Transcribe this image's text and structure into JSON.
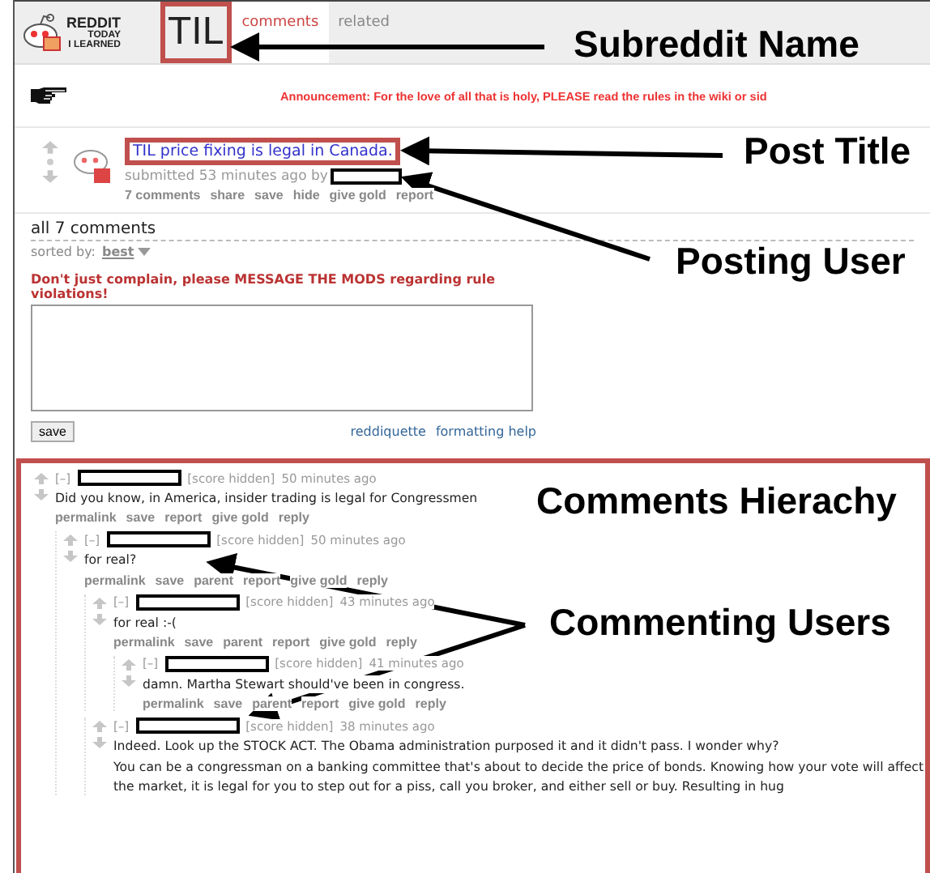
{
  "header": {
    "logo_lines": [
      "REDDIT",
      "TODAY",
      "I LEARNED"
    ],
    "subreddit": "TIL",
    "tabs": [
      {
        "label": "comments",
        "selected": true
      },
      {
        "label": "related",
        "selected": false
      }
    ]
  },
  "announcement": "Announcement: For the love of all that is holy, PLEASE read the rules in the wiki or sid",
  "post": {
    "title": "TIL price fixing is legal in Canada.",
    "submitted": "submitted 53 minutes ago by",
    "actions": [
      "7 comments",
      "share",
      "save",
      "hide",
      "give gold",
      "report"
    ]
  },
  "comments_heading": "all 7 comments",
  "sort": {
    "label": "sorted by:",
    "value": "best"
  },
  "notice": "Don't just complain, please MESSAGE THE MODS regarding rule violations!",
  "reply_form": {
    "button": "save",
    "links": [
      "reddiquette",
      "formatting help"
    ]
  },
  "comments": [
    {
      "toggle": "[–]",
      "score": "[score hidden]",
      "time": "50 minutes ago",
      "body": [
        "Did you know, in America, insider trading is legal for Congressmen"
      ],
      "actions": [
        "permalink",
        "save",
        "report",
        "give gold",
        "reply"
      ],
      "children": [
        {
          "toggle": "[–]",
          "score": "[score hidden]",
          "time": "50 minutes ago",
          "body": [
            "for real?"
          ],
          "actions": [
            "permalink",
            "save",
            "parent",
            "report",
            "give gold",
            "reply"
          ],
          "children": [
            {
              "toggle": "[–]",
              "score": "[score hidden]",
              "time": "43 minutes ago",
              "body": [
                "for real :-("
              ],
              "actions": [
                "permalink",
                "save",
                "parent",
                "report",
                "give gold",
                "reply"
              ],
              "children": [
                {
                  "toggle": "[–]",
                  "score": "[score hidden]",
                  "time": "41 minutes ago",
                  "body": [
                    "damn. Martha Stewart should've been in congress."
                  ],
                  "actions": [
                    "permalink",
                    "save",
                    "parent",
                    "report",
                    "give gold",
                    "reply"
                  ]
                }
              ]
            },
            {
              "toggle": "[–]",
              "score": "[score hidden]",
              "time": "38 minutes ago",
              "body": [
                "Indeed. Look up the STOCK ACT. The Obama administration purposed it and it didn't pass. I wonder why?",
                "You can be a congressman on a banking committee that's about to decide the price of bonds. Knowing how your vote will affect the market, it is legal for you to step out for a piss, call you broker, and either sell or buy. Resulting in hug"
              ]
            }
          ]
        }
      ]
    }
  ],
  "annotations": [
    {
      "text": "Subreddit Name"
    },
    {
      "text": "Post Title"
    },
    {
      "text": "Posting User"
    },
    {
      "text": "Comments Hierachy"
    },
    {
      "text": "Commenting Users"
    }
  ]
}
